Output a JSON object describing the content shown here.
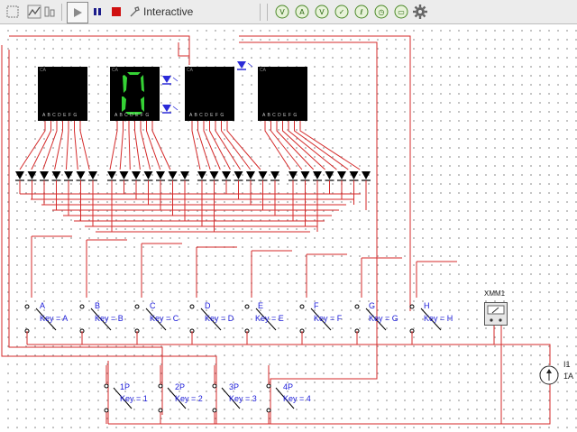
{
  "toolbar": {
    "mode_label": "Interactive",
    "icons": [
      "select-icon",
      "grapher-icon",
      "play-icon",
      "pause-icon",
      "stop-icon",
      "interactive-icon",
      "probe-v-icon",
      "probe-a-icon",
      "probe-vv-icon",
      "probe-p-icon",
      "probe-q-icon",
      "probe-r-icon",
      "settings-gear-icon"
    ]
  },
  "colors": {
    "wire": "#d42a2a",
    "label": "#1a1ad8",
    "segment_on": "#35d235",
    "led": "#2a2ad8",
    "background": "#ffffff",
    "grid_dot": "#b5b5b5"
  },
  "displays": [
    {
      "tag": "CA",
      "pins": "A B C D E F G",
      "lit": false,
      "digit": ""
    },
    {
      "tag": "CA",
      "pins": "A B C D E F G",
      "lit": true,
      "digit": "0"
    },
    {
      "tag": "CA",
      "pins": "A B C D E F G",
      "lit": false,
      "digit": ""
    },
    {
      "tag": "CA",
      "pins": "A B C D E F G",
      "lit": false,
      "digit": ""
    }
  ],
  "switches": [
    {
      "name": "A",
      "key": "Key = A"
    },
    {
      "name": "B",
      "key": "Key = B"
    },
    {
      "name": "C",
      "key": "Key = C"
    },
    {
      "name": "D",
      "key": "Key = D"
    },
    {
      "name": "E",
      "key": "Key = E"
    },
    {
      "name": "F",
      "key": "Key = F"
    },
    {
      "name": "G",
      "key": "Key = G"
    },
    {
      "name": "H",
      "key": "Key = H"
    }
  ],
  "selectors": [
    {
      "name": "1P",
      "key": "Key = 1"
    },
    {
      "name": "2P",
      "key": "Key = 2"
    },
    {
      "name": "3P",
      "key": "Key = 3"
    },
    {
      "name": "4P",
      "key": "Key = 4"
    }
  ],
  "meter": {
    "name": "XMM1"
  },
  "source": {
    "name": "I1",
    "value": "1A"
  }
}
